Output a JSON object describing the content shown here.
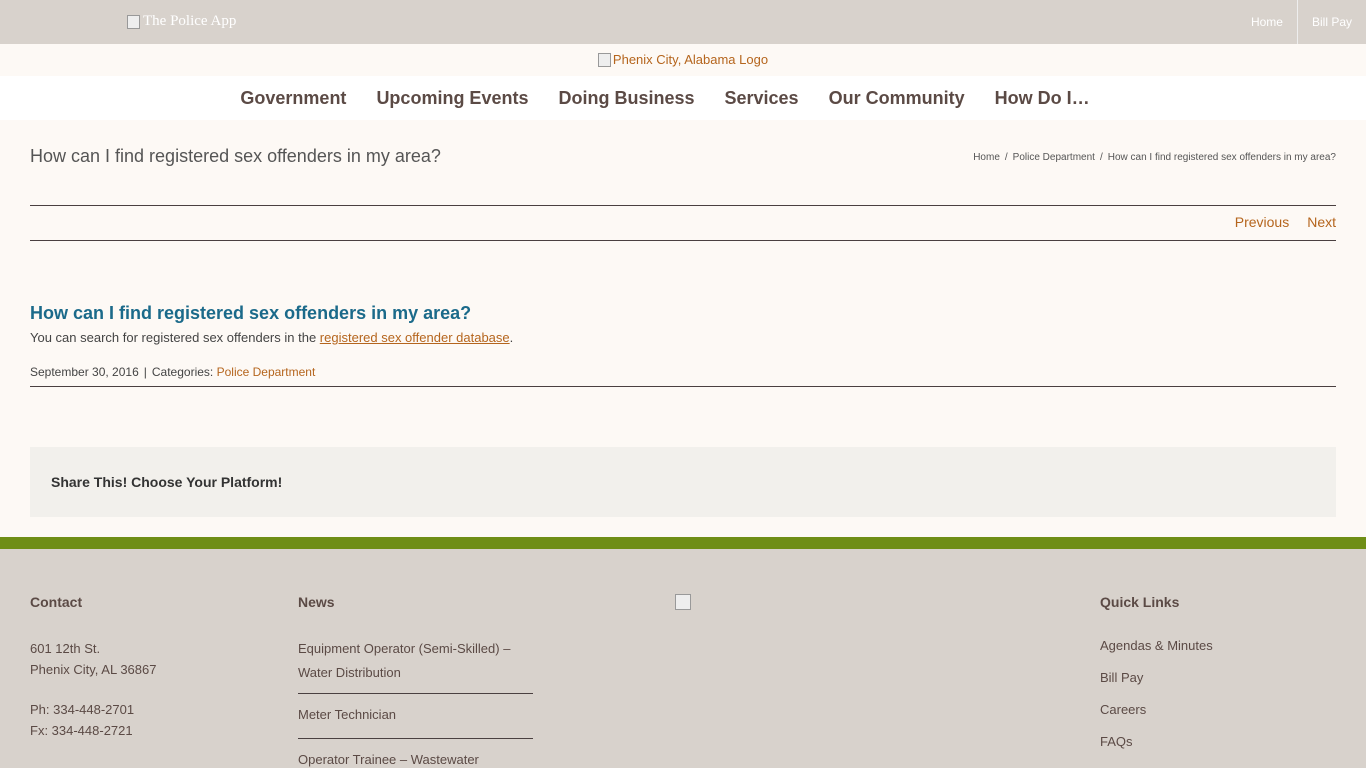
{
  "topbar": {
    "social_icons": [
      "facebook-icon",
      "twitter-icon",
      "youtube-icon"
    ],
    "police_app_alt": "The Police App",
    "links": [
      "Home",
      "Bill Pay"
    ]
  },
  "logo": {
    "alt": "Phenix City, Alabama Logo"
  },
  "nav": {
    "items": [
      "Government",
      "Upcoming Events",
      "Doing Business",
      "Services",
      "Our Community",
      "How Do I…"
    ],
    "search_icon": "search-icon"
  },
  "page": {
    "title": "How can I find registered sex offenders in my area?",
    "breadcrumb": [
      "Home",
      "Police Department",
      "How can I find registered sex offenders in my area?"
    ],
    "previous_label": "Previous",
    "next_label": "Next"
  },
  "post": {
    "title": "How can I find registered sex offenders in my area?",
    "body_prefix": "You can search for registered sex offenders in the ",
    "body_link": "registered sex offender database",
    "body_suffix": ".",
    "date": "September 30, 2016",
    "categories_label": "Categories:",
    "category": "Police Department"
  },
  "share": {
    "title": "Share This! Choose Your Platform!",
    "icons": [
      "facebook-icon",
      "twitter-icon",
      "linkedin-icon",
      "pinterest-icon",
      "vk-icon",
      "email-icon"
    ]
  },
  "footer": {
    "contact": {
      "heading": "Contact",
      "address1": "601 12th St.",
      "address2": "Phenix City, AL 36867",
      "phone": "Ph: 334-448-2701",
      "fax": "Fx: 334-448-2721"
    },
    "news": {
      "heading": "News",
      "items": [
        "Equipment Operator (Semi-Skilled) – Water Distribution",
        "Meter Technician",
        "Operator Trainee – Wastewater"
      ]
    },
    "quick_links": {
      "heading": "Quick Links",
      "items": [
        "Agendas & Minutes",
        "Bill Pay",
        "Careers",
        "FAQs"
      ]
    }
  },
  "colors": {
    "accent": "#b5651d",
    "title_blue": "#1b6a8a",
    "green_bar": "#6f8e16",
    "taupe": "#d8d2cc"
  }
}
